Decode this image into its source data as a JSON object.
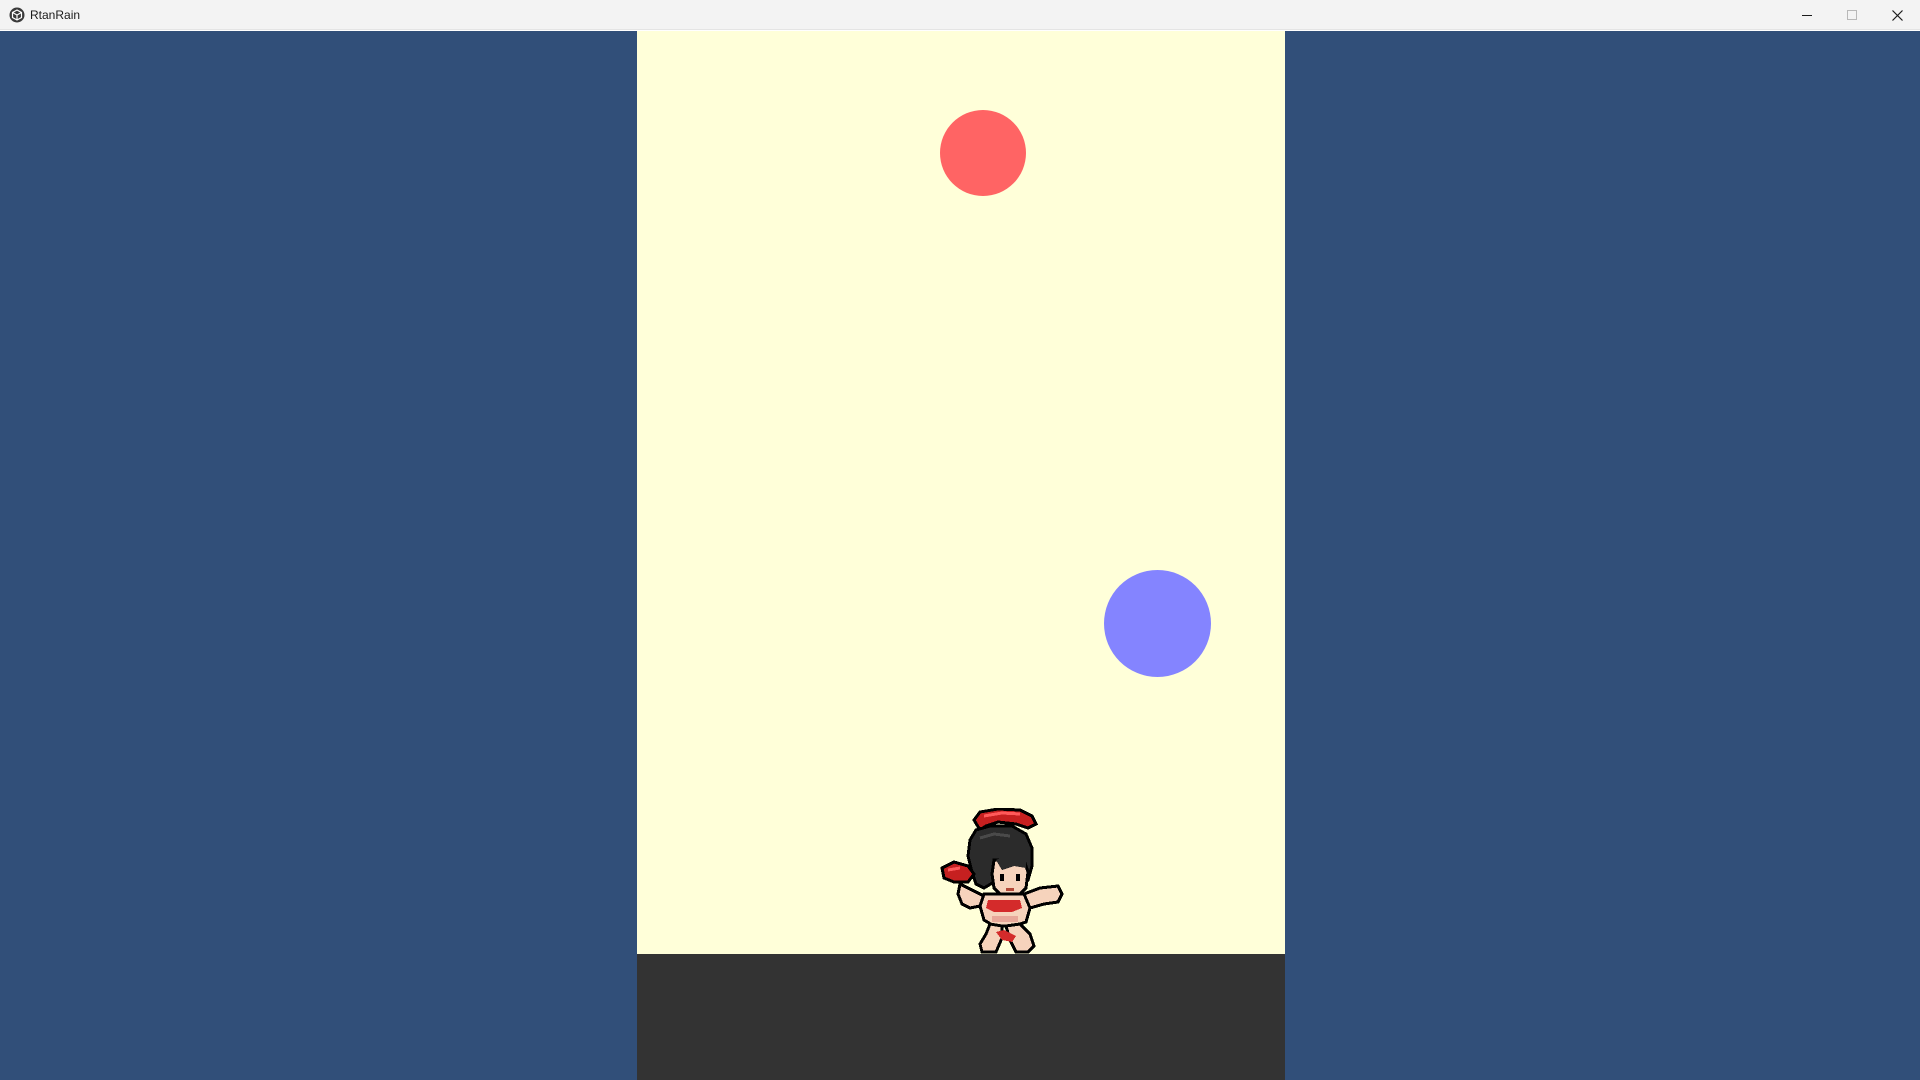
{
  "window": {
    "title": "RtanRain",
    "icon": "unity-cube-icon",
    "controls": [
      "minimize-icon",
      "maximize-icon",
      "close-icon"
    ]
  },
  "game": {
    "background_color": "#314f79",
    "playfield_color": "#ffffd9",
    "ground_color": "#333333",
    "player": {
      "name": "rtan-character",
      "accent_color": "#d42b2b"
    },
    "balls": [
      {
        "kind": "red-rain-drop",
        "color": "#ff6464"
      },
      {
        "kind": "blue-rain-drop",
        "color": "#8484ff"
      }
    ]
  }
}
